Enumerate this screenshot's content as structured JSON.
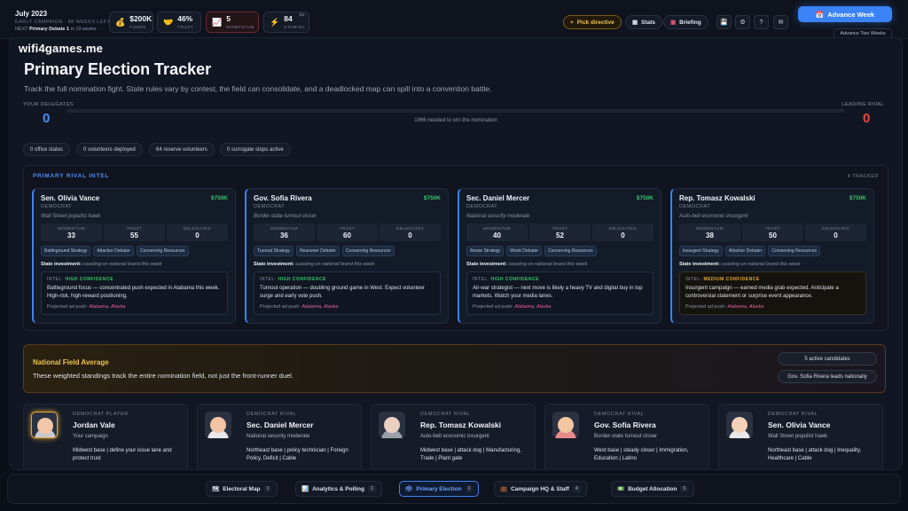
{
  "header": {
    "date": "July 2023",
    "campaign_line": "EARLY CAMPAIGN · 88 WEEKS LEFT",
    "next_label": "NEXT",
    "next_event": "Primary Debate 1",
    "next_when": "in 19 weeks",
    "stats": [
      {
        "icon": "money-bag-icon",
        "glyph": "💰",
        "value": "$200K",
        "label": "FUNDS"
      },
      {
        "icon": "handshake-icon",
        "glyph": "🤝",
        "value": "46%",
        "label": "TRUST"
      },
      {
        "icon": "chart-icon",
        "glyph": "📈",
        "value": "5",
        "label": "MOMENTUM"
      },
      {
        "icon": "lightning-icon",
        "glyph": "⚡",
        "value": "84",
        "label": "STAMINA",
        "badge": "64"
      }
    ],
    "directive_label": "Pick directive",
    "stats_label": "Stats",
    "briefing_label": "Briefing",
    "advance_week": "Advance Week",
    "advance_two": "Advance Two Weeks"
  },
  "main": {
    "logo": "wifi4games.me",
    "title": "Primary Election Tracker",
    "description": "Track the full nomination fight. State rules vary by contest, the field can consolidate, and a deadlocked map can spill into a convention battle.",
    "your_delegates_label": "YOUR DELEGATES",
    "your_delegates": "0",
    "leading_rival_label": "LEADING RIVAL",
    "leading_rival": "0",
    "needed_text": "1966 needed to win the nomination",
    "chips": [
      "0 office states",
      "0 volunteers deployed",
      "64 reserve volunteers",
      "0 surrogate stops active"
    ],
    "intel_title": "PRIMARY RIVAL INTEL",
    "intel_count": "4 TRACKED",
    "metric_labels": [
      "MOMENTUM",
      "TRUST",
      "DELEGATES"
    ],
    "state_investment_label": "State investment:",
    "intel_label": "INTEL:",
    "projected_label": "Projected ad push:",
    "rivals": [
      {
        "name": "Sen. Olivia Vance",
        "funds": "$750K",
        "party": "DEMOCRAT",
        "archetype": "Wall Street populist hawk",
        "momentum": "33",
        "trust": "55",
        "delegates": "0",
        "tags": [
          "Battleground Strategy",
          "Attacker Debater",
          "Conserving Resources"
        ],
        "investment": "coasting on national brand this week",
        "confidence": "HIGH CONFIDENCE",
        "confidence_level": "high",
        "intel": "Battleground focus — concentrated push expected in Alabama this week. High-risk, high-reward positioning.",
        "projected": "Alabama, Alaska"
      },
      {
        "name": "Gov. Sofia Rivera",
        "funds": "$750K",
        "party": "DEMOCRAT",
        "archetype": "Border-state turnout closer",
        "momentum": "36",
        "trust": "60",
        "delegates": "0",
        "tags": [
          "Turnout Strategy",
          "Reasoner Debater",
          "Conserving Resources"
        ],
        "investment": "coasting on national brand this week",
        "confidence": "HIGH CONFIDENCE",
        "confidence_level": "high",
        "intel": "Turnout operation — doubling ground game in West. Expect volunteer surge and early vote push.",
        "projected": "Alabama, Alaska"
      },
      {
        "name": "Sec. Daniel Mercer",
        "funds": "$750K",
        "party": "DEMOCRAT",
        "archetype": "National security moderate",
        "momentum": "40",
        "trust": "52",
        "delegates": "0",
        "tags": [
          "Airwar Strategy",
          "Wonk Debater",
          "Conserving Resources"
        ],
        "investment": "coasting on national brand this week",
        "confidence": "HIGH CONFIDENCE",
        "confidence_level": "high",
        "intel": "Air-war strategist — next move is likely a heavy TV and digital buy in top markets. Watch your media lanes.",
        "projected": "Alabama, Alaska"
      },
      {
        "name": "Rep. Tomasz Kowalski",
        "funds": "$750K",
        "party": "DEMOCRAT",
        "archetype": "Auto-belt economic insurgent",
        "momentum": "38",
        "trust": "50",
        "delegates": "0",
        "tags": [
          "Insurgent Strategy",
          "Attacker Debater",
          "Conserving Resources"
        ],
        "investment": "coasting on national brand this week",
        "confidence": "MEDIUM CONFIDENCE",
        "confidence_level": "medium",
        "intel": "Insurgent campaign — earned media grab expected. Anticipate a controversial statement or surprise event appearance.",
        "projected": "Alabama, Alaska"
      }
    ],
    "field": {
      "title": "National Field Average",
      "description": "These weighted standings track the entire nomination field, not just the front-runner duel.",
      "active": "5 active candidates",
      "leader": "Gov. Sofia Rivera leads nationally"
    },
    "candidates": [
      {
        "role": "DEMOCRAT  PLAYER",
        "name": "Jordan Vale",
        "tagline": "Your campaign",
        "desc": "Midwest base | define your issue lane and protect trust",
        "avatar": "player-avatar"
      },
      {
        "role": "DEMOCRAT  RIVAL",
        "name": "Sec. Daniel Mercer",
        "tagline": "National security moderate",
        "desc": "Northeast base | policy technician | Foreign Policy, Deficit | Cable",
        "avatar": "mercer-avatar"
      },
      {
        "role": "DEMOCRAT  RIVAL",
        "name": "Rep. Tomasz Kowalski",
        "tagline": "Auto-belt economic insurgent",
        "desc": "Midwest base | attack dog | Manufacturing, Trade | Plant gate",
        "avatar": "kowalski-avatar"
      },
      {
        "role": "DEMOCRAT  RIVAL",
        "name": "Gov. Sofia Rivera",
        "tagline": "Border-state turnout closer",
        "desc": "West base | steady closer | Immigration, Education | Latino",
        "avatar": "rivera-avatar"
      },
      {
        "role": "DEMOCRAT  RIVAL",
        "name": "Sen. Olivia Vance",
        "tagline": "Wall Street populist hawk",
        "desc": "Northeast base | attack dog | Inequality, Healthcare | Cable",
        "avatar": "vance-avatar"
      }
    ]
  },
  "nav": {
    "tabs": [
      {
        "label": "Electoral Map",
        "num": "1",
        "icon": "map-icon",
        "glyph": "🗺"
      },
      {
        "label": "Analytics & Polling",
        "num": "2",
        "icon": "bar-chart-icon",
        "glyph": "📊"
      },
      {
        "label": "Primary Election",
        "num": "3",
        "icon": "ballot-icon",
        "glyph": "🗳"
      },
      {
        "label": "Campaign HQ & Staff",
        "num": "4",
        "icon": "hq-icon",
        "glyph": "💼"
      },
      {
        "label": "Budget Allocation",
        "num": "5",
        "icon": "money-icon",
        "glyph": "💵"
      }
    ]
  },
  "colors": {
    "accent": "#3b82f6",
    "funds_green": "#39c46a",
    "directive_gold": "#f0c453",
    "rival_red": "#ef4444",
    "delegate_blue": "#4f8cf5"
  }
}
